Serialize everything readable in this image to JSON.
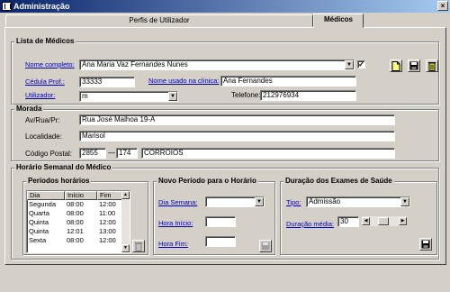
{
  "window": {
    "title": "Administração"
  },
  "tabs": [
    {
      "label": "Perfis de Utilizador"
    },
    {
      "label": "Médicos"
    }
  ],
  "lista": {
    "title": "Lista de Médicos",
    "nome_label": "Nome completo:",
    "nome_value": "Ana Maria Vaz Fernandes Nunes",
    "nome_checked": true,
    "cedula_label": "Cédula Prof.:",
    "cedula_value": "33333",
    "nome_clinica_label": "Nome usado na clínica:",
    "nome_clinica_value": "Ana Fernandes",
    "utilizador_label": "Utilizador:",
    "utilizador_value": "m",
    "telefone_label": "Telefone:",
    "telefone_value": "212976934"
  },
  "morada": {
    "title": "Morada",
    "av_label": "Av/Rua/Pr:",
    "av_value": "Rua José Malhoa 19-A",
    "localidade_label": "Localidade:",
    "localidade_value": "Marisol",
    "cp_label": "Código Postal:",
    "cp_1": "2855",
    "cp_sep": "—",
    "cp_2": "174",
    "cp_local": "CORROIOS"
  },
  "horario": {
    "title": "Horário Semanal do Médico",
    "periodos_title": "Períodos horários",
    "columns": [
      "Dia",
      "Início",
      "Fim"
    ],
    "rows": [
      [
        "Segunda",
        "08:00",
        "12:00"
      ],
      [
        "Quarta",
        "08:00",
        "11:00"
      ],
      [
        "Quinta",
        "08:00",
        "12:00"
      ],
      [
        "Quinta",
        "12:01",
        "13:00"
      ],
      [
        "Sexta",
        "08:00",
        "12:00"
      ]
    ],
    "novo_title": "Novo Período para o Horário",
    "dia_label": "Dia Semana:",
    "dia_value": "",
    "hora_inicio_label": "Hora Início:",
    "hora_fim_label": "Hora Fim:",
    "duracao_title": "Duração dos Exames de Saúde",
    "tipo_label": "Tipo:",
    "tipo_value": "Admissão",
    "duracao_label": "Duração média:",
    "duracao_value": "30"
  },
  "icons": {
    "new": "new-document-icon",
    "save": "floppy-disk-icon",
    "delete": "trash-icon"
  }
}
